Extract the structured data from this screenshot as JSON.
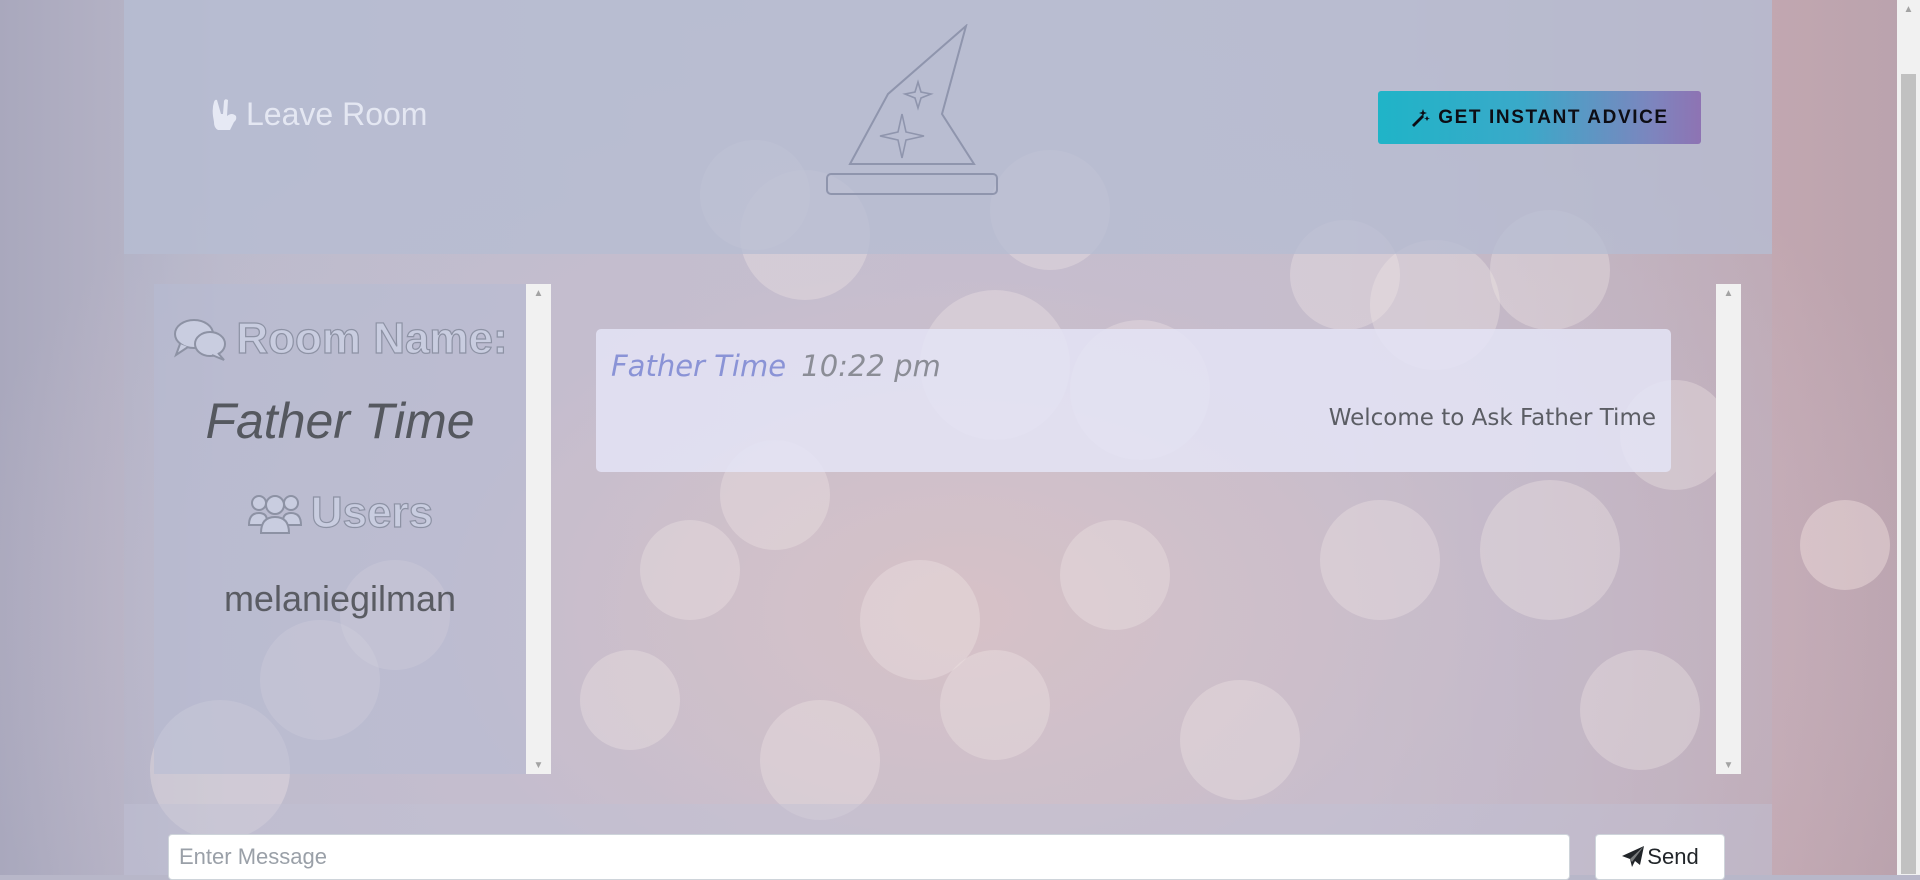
{
  "header": {
    "leave_label": "Leave Room",
    "advice_label": "GET INSTANT ADVICE"
  },
  "sidebar": {
    "room_heading": "Room Name:",
    "room_name": "Father Time",
    "users_heading": "Users",
    "users": [
      "melaniegilman"
    ]
  },
  "chat": {
    "messages": [
      {
        "author": "Father Time",
        "time": "10:22 pm",
        "text": "Welcome to Ask Father Time"
      }
    ]
  },
  "composer": {
    "placeholder": "Enter Message",
    "send_label": "Send"
  },
  "colors": {
    "advice_gradient_start": "#1fb4c8",
    "advice_gradient_end": "#8e73b3",
    "author_color": "#8a93d6"
  },
  "icons": {
    "leave": "hand-peace-icon",
    "logo": "wizard-hat-icon",
    "advice": "magic-wand-icon",
    "room": "comments-icon",
    "users": "users-icon",
    "send": "paper-plane-icon"
  }
}
